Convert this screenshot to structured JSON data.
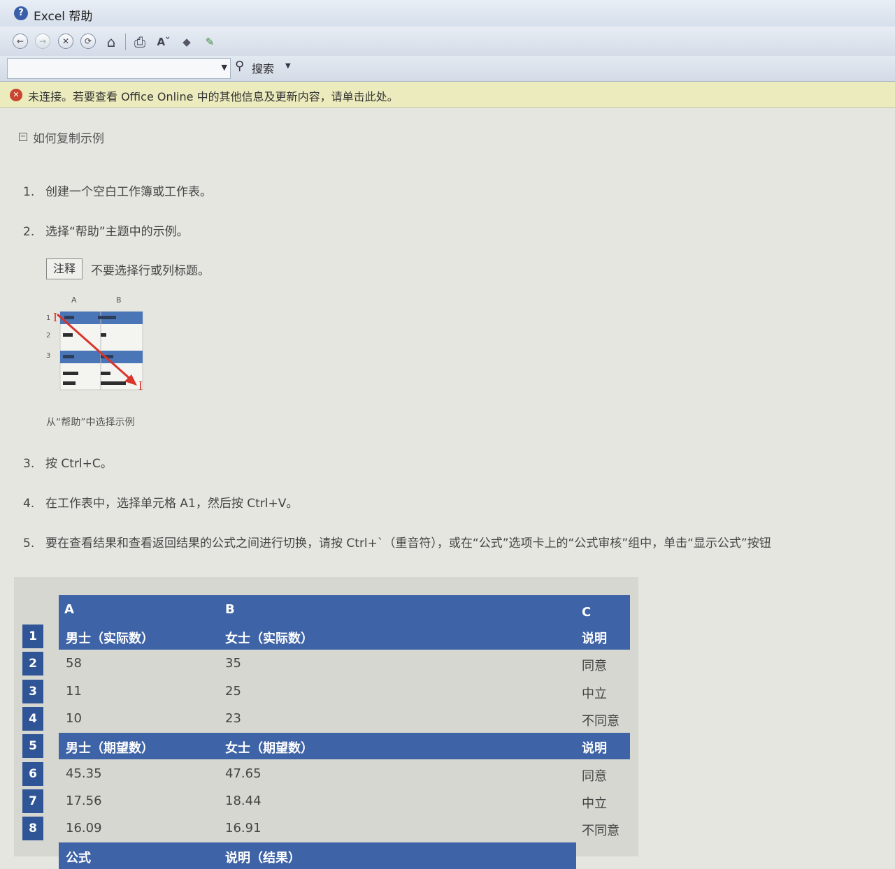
{
  "window": {
    "title": "Excel 帮助",
    "icon": "help-icon"
  },
  "toolbar": {
    "buttons": [
      {
        "name": "back-icon",
        "glyph": "←"
      },
      {
        "name": "forward-icon",
        "glyph": "→"
      },
      {
        "name": "stop-icon",
        "glyph": "✕"
      },
      {
        "name": "refresh-icon",
        "glyph": "⟳"
      },
      {
        "name": "home-icon",
        "glyph": "⌂"
      },
      {
        "name": "print-icon",
        "glyph": "⎙"
      },
      {
        "name": "font-size-icon",
        "glyph": "Aˇ"
      },
      {
        "name": "table-of-contents-icon",
        "glyph": "◆"
      },
      {
        "name": "pin-icon",
        "glyph": "✎"
      }
    ]
  },
  "search": {
    "value": "",
    "placeholder": "",
    "button_label": "搜索"
  },
  "infobar": {
    "text": "未连接。若要查看 Office Online 中的其他信息及更新内容，请单击此处。"
  },
  "section": {
    "toggle": "⊟",
    "title": "如何复制示例"
  },
  "steps": [
    {
      "num": "1.",
      "text": "创建一个空白工作簿或工作表。"
    },
    {
      "num": "2.",
      "text": "选择“帮助”主题中的示例。"
    },
    {
      "num": "3.",
      "text": "按 Ctrl+C。"
    },
    {
      "num": "4.",
      "text": "在工作表中，选择单元格 A1，然后按 Ctrl+V。"
    },
    {
      "num": "5.",
      "text": "要在查看结果和查看返回结果的公式之间进行切换，请按 Ctrl+`（重音符），或在“公式”选项卡上的“公式审核”组中，单击“显示公式”按钮"
    }
  ],
  "note": {
    "label": "注释",
    "text": "不要选择行或列标题。"
  },
  "diagram": {
    "col_a": "A",
    "col_b": "B",
    "row_1": "1",
    "row_2": "2",
    "row_3": "3",
    "caption": "从“帮助”中选择示例"
  },
  "table": {
    "columns": [
      "A",
      "B",
      "C"
    ],
    "row_numbers": [
      "1",
      "2",
      "3",
      "4",
      "5",
      "6",
      "7",
      "8"
    ],
    "rows": [
      {
        "header": true,
        "cells": [
          "男士（实际数）",
          "女士（实际数）",
          "说明"
        ]
      },
      {
        "header": false,
        "cells": [
          "58",
          "35",
          "同意"
        ]
      },
      {
        "header": false,
        "cells": [
          "11",
          "25",
          "中立"
        ]
      },
      {
        "header": false,
        "cells": [
          "10",
          "23",
          "不同意"
        ]
      },
      {
        "header": true,
        "cells": [
          "男士（期望数）",
          "女士（期望数）",
          "说明"
        ]
      },
      {
        "header": false,
        "cells": [
          "45.35",
          "47.65",
          "同意"
        ]
      },
      {
        "header": false,
        "cells": [
          "17.56",
          "18.44",
          "中立"
        ]
      },
      {
        "header": false,
        "cells": [
          "16.09",
          "16.91",
          "不同意"
        ]
      }
    ],
    "partial_row": [
      "公式",
      "说明（结果）"
    ]
  },
  "colors": {
    "accent": "#3e63a6",
    "rownum": "#2f5597",
    "infobar": "#ecebbd",
    "arrow": "#d8352b"
  }
}
